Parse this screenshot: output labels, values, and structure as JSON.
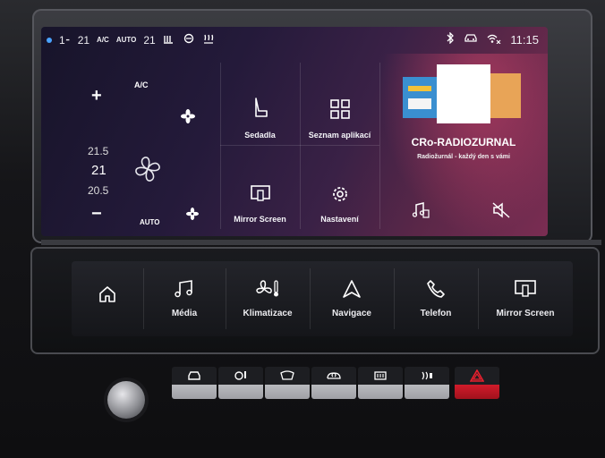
{
  "status_bar": {
    "seat_heat_left": "1⁃",
    "temp_left": "21",
    "ac_mode": "A/C",
    "auto_mode": "AUTO",
    "temp_right": "21",
    "time": "11:15"
  },
  "climate": {
    "plus": "+",
    "minus": "−",
    "ac_label": "A/C",
    "temp_upper": "21.5",
    "temp_current": "21",
    "temp_lower": "20.5",
    "auto_label": "AUTO"
  },
  "tiles": {
    "seats": "Sedadla",
    "apps": "Seznam aplikací",
    "mirror": "Mirror Screen",
    "settings": "Nastavení"
  },
  "radio": {
    "station": "CRo-RADIOZURNAL",
    "subtitle": "Radiožurnál - každý den s vámi"
  },
  "touchbar": {
    "home_label": "",
    "media": "Média",
    "climate": "Klimatizace",
    "navigation": "Navigace",
    "phone": "Telefon",
    "mirror": "Mirror Screen"
  },
  "colors": {
    "hazard": "#d01b2a",
    "bluetooth_dot": "#4aa3ff",
    "art_main": "#ffffff",
    "art_right": "#e8a457"
  },
  "icons": {
    "fan": "fan-icon",
    "seat": "seat-icon",
    "apps": "grid-icon",
    "mirror": "mirror-screen-icon",
    "settings": "gear-icon",
    "music": "music-note-icon",
    "mute": "speaker-mute-icon",
    "home": "home-icon",
    "nav": "navigation-arrow-icon",
    "phone": "phone-icon"
  }
}
